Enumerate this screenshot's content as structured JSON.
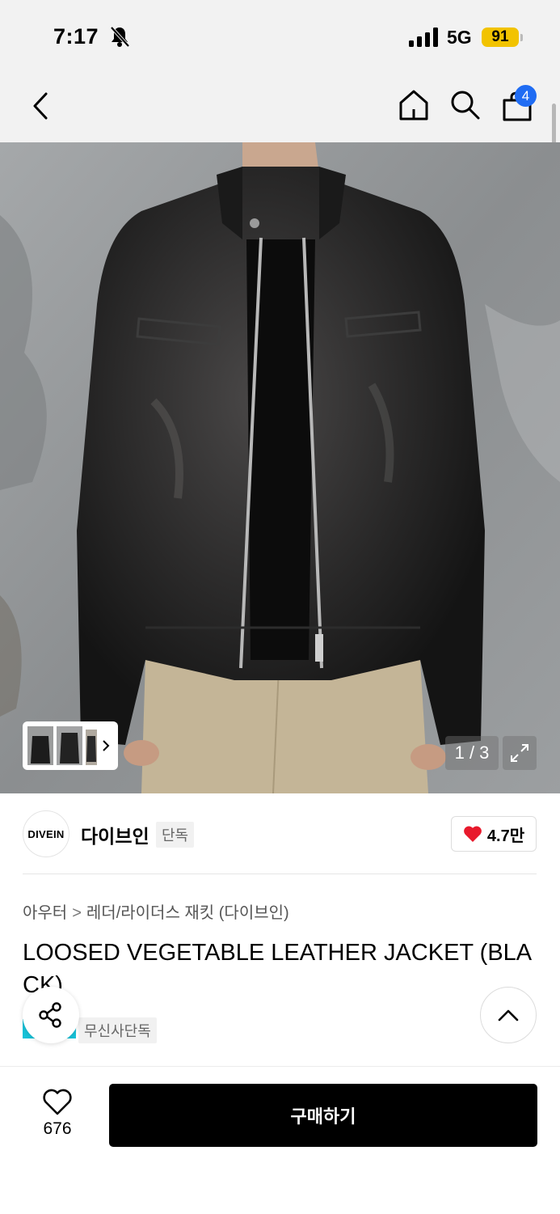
{
  "status_bar": {
    "time": "7:17",
    "network": "5G",
    "battery": "91"
  },
  "nav": {
    "cart_count": "4"
  },
  "gallery": {
    "counter": "1 / 3"
  },
  "brand": {
    "logo_text": "DIVEIN",
    "name": "다이브인",
    "tag": "단독",
    "likes": "4.7만"
  },
  "breadcrumb": {
    "category": "아우터",
    "subcategory": "레더/라이더스 재킷 (다이브인)"
  },
  "product": {
    "title": "LOOSED VEGETABLE LEATHER JACKET (BLACK)",
    "exclusive_tag": "무신사단독"
  },
  "bottom_bar": {
    "wish_count": "676",
    "buy_label": "구매하기"
  },
  "colors": {
    "accent_blue": "#1f6cf3",
    "heart_red": "#e8192c",
    "battery_yellow": "#f2c300",
    "badge_cyan": "#17c2d8"
  }
}
